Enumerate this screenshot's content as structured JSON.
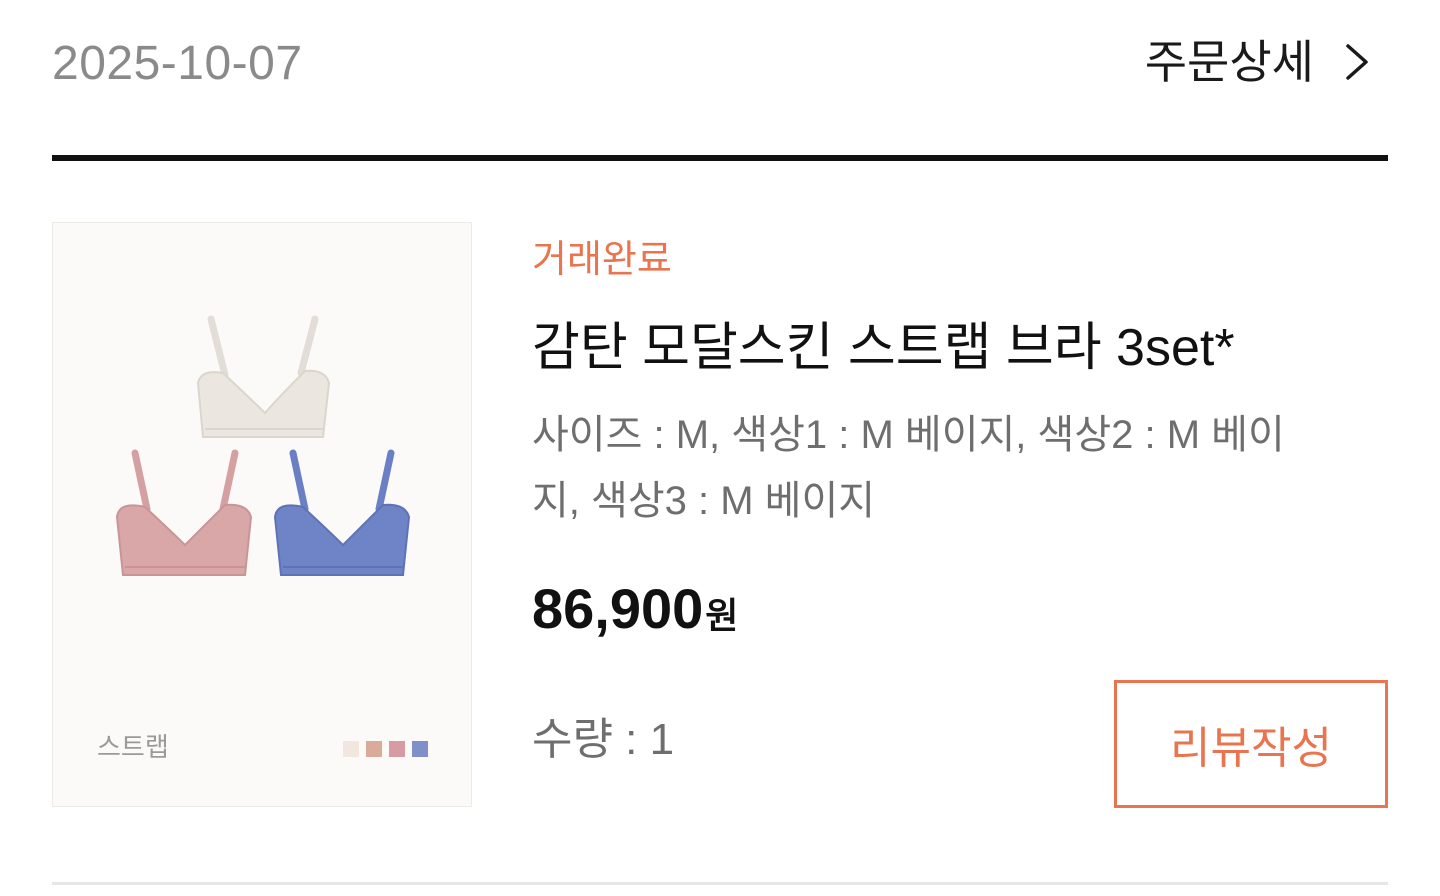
{
  "order": {
    "date": "2025-10-07",
    "detail_label": "주문상세"
  },
  "product": {
    "status": "거래완료",
    "name": "감탄 모달스킨 스트랩 브라 3set*",
    "options": "사이즈 : M, 색상1 : M 베이지, 색상2 : M 베이지, 색상3 : M 베이지",
    "price": "86,900",
    "price_unit": "원",
    "quantity": "수량 : 1",
    "review_button": "리뷰작성"
  },
  "thumbnail": {
    "caption": "스트랩",
    "colors": {
      "ivory": "#ebe6df",
      "pink": "#d9a7a8",
      "blue": "#6f84c7",
      "swatch_1": "#f2e6df",
      "swatch_2": "#d9ab98",
      "swatch_3": "#d99ba3",
      "swatch_4": "#7f8fc9"
    }
  },
  "colors": {
    "accent": "#e8754f",
    "text_primary": "#111111",
    "text_secondary": "#6e6e6e",
    "text_muted": "#8a8a8a"
  }
}
